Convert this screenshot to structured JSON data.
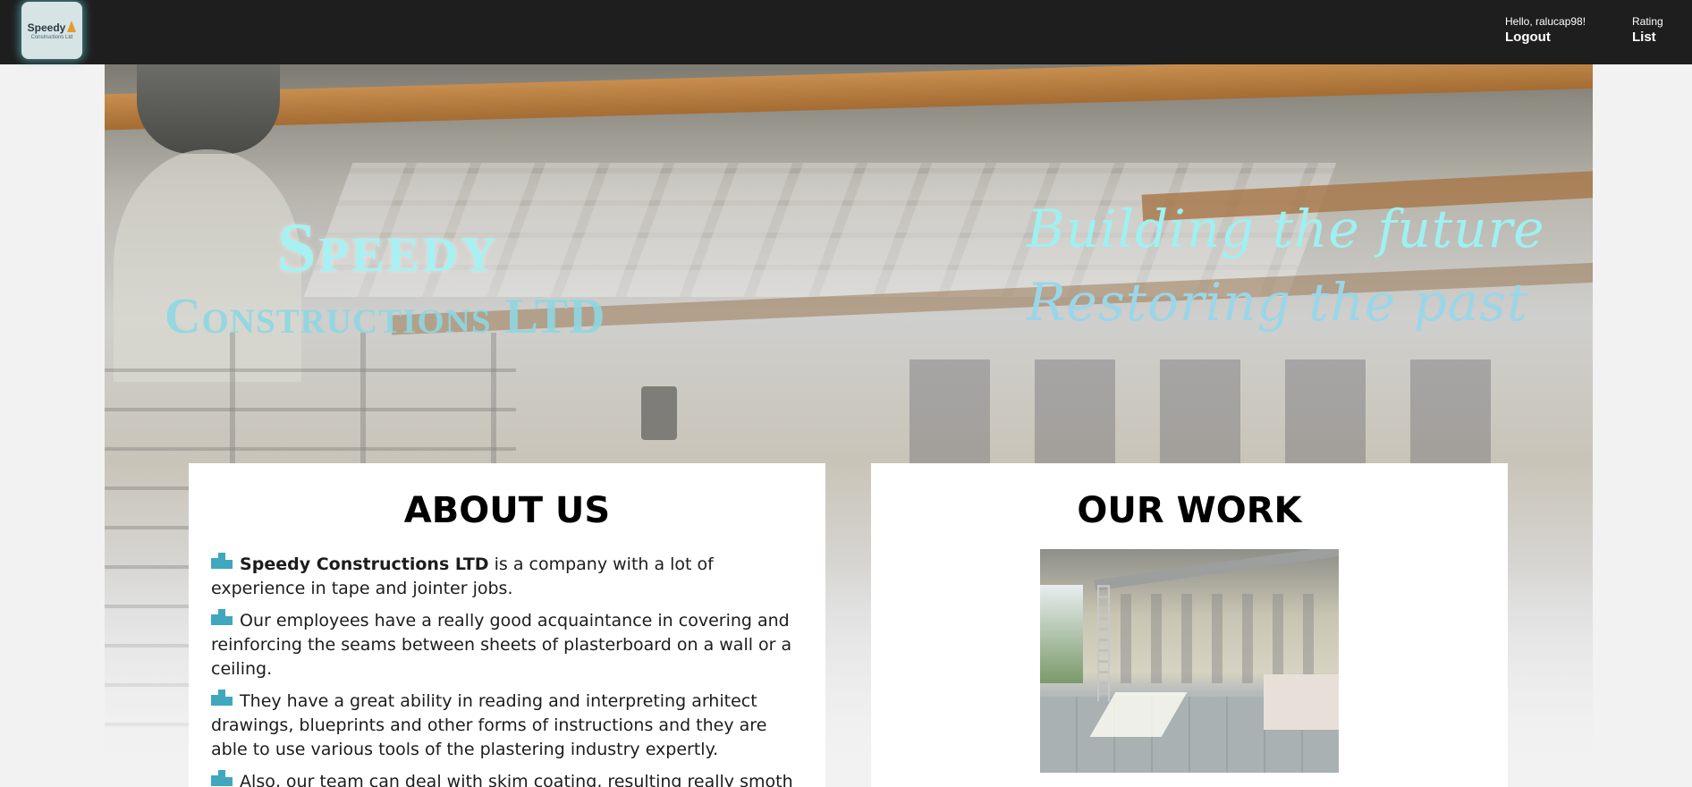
{
  "header": {
    "logo": {
      "line1": "Speedy",
      "line2": "Constructions Ltd"
    },
    "greeting": "Hello, ralucap98!",
    "logout_label": "Logout",
    "rating_label": "Rating",
    "list_label": "List"
  },
  "hero": {
    "brand_line1": "Speedy",
    "brand_line2": "Constructions LTD",
    "tagline_line1": "Building the future",
    "tagline_line2": "Restoring the past"
  },
  "about": {
    "title": "ABOUT US",
    "p1_bold": "Speedy Constructions LTD",
    "p1_rest": " is a company with a lot of experience in tape and jointer jobs.",
    "p2": " Our employees have a really good acquaintance in covering and reinforcing the seams between sheets of plasterboard on a wall or a ceiling.",
    "p3": " They have a great ability in reading and interpreting arhitect drawings, blueprints and other forms of instructions and they are able to use various tools of the plastering industry expertly.",
    "p4": " Also, our team can deal with skim coating, resulting really smoth walls."
  },
  "work": {
    "title": "OUR WORK"
  },
  "icons": {
    "logo": "cone-icon",
    "paragraph_bullet": "building-icon"
  },
  "colors": {
    "topbar": "#1e1e1e",
    "accent": "#3fa7bf",
    "hero_text": "#a6f1f3"
  }
}
